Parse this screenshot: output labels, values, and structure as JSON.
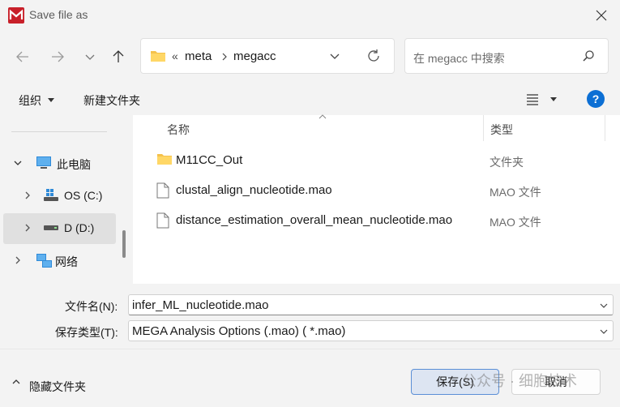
{
  "window": {
    "title": "Save file as"
  },
  "navigation": {
    "breadcrumb_overflow": "«",
    "path": [
      "meta",
      "megacc"
    ],
    "search_placeholder": "在 megacc 中搜索"
  },
  "toolbar": {
    "organize_label": "组织",
    "new_folder_label": "新建文件夹",
    "help_label": "?"
  },
  "sidebar": {
    "items": [
      {
        "label": "此电脑",
        "icon": "computer-icon",
        "expanded": true
      },
      {
        "label": "OS (C:)",
        "icon": "drive-icon",
        "expanded": false
      },
      {
        "label": "D (D:)",
        "icon": "drive-icon",
        "expanded": false,
        "selected": true
      },
      {
        "label": "网络",
        "icon": "network-icon",
        "expanded": false
      }
    ]
  },
  "file_list": {
    "columns": {
      "name": "名称",
      "type": "类型"
    },
    "files": [
      {
        "name": "M11CC_Out",
        "type": "文件夹",
        "icon": "folder-icon"
      },
      {
        "name": "clustal_align_nucleotide.mao",
        "type": "MAO 文件",
        "icon": "file-icon"
      },
      {
        "name": "distance_estimation_overall_mean_nucleotide.mao",
        "type": "MAO 文件",
        "icon": "file-icon"
      }
    ]
  },
  "form": {
    "filename_label": "文件名(N):",
    "filename_value": "infer_ML_nucleotide.mao",
    "filetype_label": "保存类型(T):",
    "filetype_value": "MEGA Analysis Options (.mao)  ( *.mao)"
  },
  "footer": {
    "hide_folders_label": "隐藏文件夹",
    "save_label": "保存(S)",
    "cancel_label": "取消",
    "watermark": "公众号 · 细胞技术"
  },
  "colors": {
    "accent": "#0c6fd4",
    "app_icon": "#c8202a",
    "folder": "#f5c24c"
  }
}
